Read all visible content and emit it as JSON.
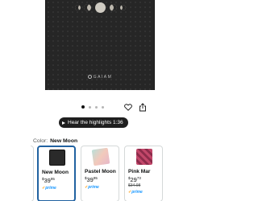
{
  "product": {
    "brand": "GAIAM"
  },
  "gallery": {
    "dots": [
      true,
      false,
      false,
      false
    ]
  },
  "actions": {
    "highlights_label": "Hear the highlights 1:36"
  },
  "color": {
    "label": "Color:",
    "selected": "New Moon"
  },
  "swatches": [
    {
      "name": "New Moon",
      "price_whole": "39",
      "price_fraction": "95",
      "was": "",
      "prime": "prime"
    },
    {
      "name": "Pastel Moon...",
      "price_whole": "39",
      "price_fraction": "95",
      "was": "",
      "prime": "prime"
    },
    {
      "name": "Pink Mar",
      "price_whole": "29",
      "price_fraction": "73",
      "was": "$34.98",
      "prime": "prime"
    }
  ],
  "colors": {
    "accent": "#2162a1",
    "prime": "#1a98ff",
    "pill": "#1f1f1f"
  },
  "icons": [
    "heart-icon",
    "share-icon",
    "play-icon"
  ]
}
